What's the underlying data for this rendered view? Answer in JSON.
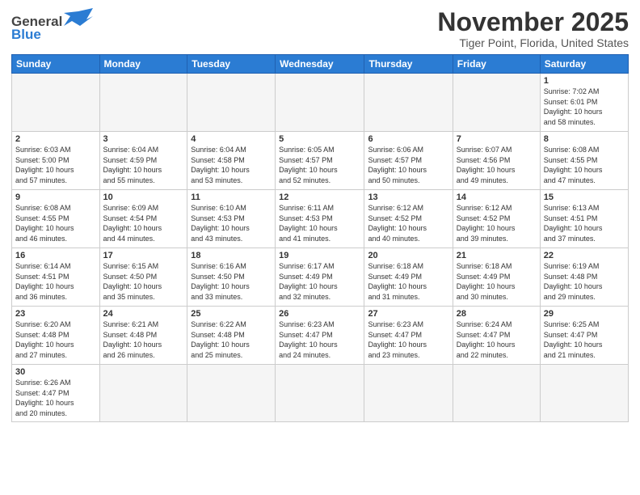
{
  "logo": {
    "text_general": "General",
    "text_blue": "Blue"
  },
  "title": "November 2025",
  "subtitle": "Tiger Point, Florida, United States",
  "days_of_week": [
    "Sunday",
    "Monday",
    "Tuesday",
    "Wednesday",
    "Thursday",
    "Friday",
    "Saturday"
  ],
  "weeks": [
    [
      {
        "day": "",
        "info": ""
      },
      {
        "day": "",
        "info": ""
      },
      {
        "day": "",
        "info": ""
      },
      {
        "day": "",
        "info": ""
      },
      {
        "day": "",
        "info": ""
      },
      {
        "day": "",
        "info": ""
      },
      {
        "day": "1",
        "info": "Sunrise: 7:02 AM\nSunset: 6:01 PM\nDaylight: 10 hours\nand 58 minutes."
      }
    ],
    [
      {
        "day": "2",
        "info": "Sunrise: 6:03 AM\nSunset: 5:00 PM\nDaylight: 10 hours\nand 57 minutes."
      },
      {
        "day": "3",
        "info": "Sunrise: 6:04 AM\nSunset: 4:59 PM\nDaylight: 10 hours\nand 55 minutes."
      },
      {
        "day": "4",
        "info": "Sunrise: 6:04 AM\nSunset: 4:58 PM\nDaylight: 10 hours\nand 53 minutes."
      },
      {
        "day": "5",
        "info": "Sunrise: 6:05 AM\nSunset: 4:57 PM\nDaylight: 10 hours\nand 52 minutes."
      },
      {
        "day": "6",
        "info": "Sunrise: 6:06 AM\nSunset: 4:57 PM\nDaylight: 10 hours\nand 50 minutes."
      },
      {
        "day": "7",
        "info": "Sunrise: 6:07 AM\nSunset: 4:56 PM\nDaylight: 10 hours\nand 49 minutes."
      },
      {
        "day": "8",
        "info": "Sunrise: 6:08 AM\nSunset: 4:55 PM\nDaylight: 10 hours\nand 47 minutes."
      }
    ],
    [
      {
        "day": "9",
        "info": "Sunrise: 6:08 AM\nSunset: 4:55 PM\nDaylight: 10 hours\nand 46 minutes."
      },
      {
        "day": "10",
        "info": "Sunrise: 6:09 AM\nSunset: 4:54 PM\nDaylight: 10 hours\nand 44 minutes."
      },
      {
        "day": "11",
        "info": "Sunrise: 6:10 AM\nSunset: 4:53 PM\nDaylight: 10 hours\nand 43 minutes."
      },
      {
        "day": "12",
        "info": "Sunrise: 6:11 AM\nSunset: 4:53 PM\nDaylight: 10 hours\nand 41 minutes."
      },
      {
        "day": "13",
        "info": "Sunrise: 6:12 AM\nSunset: 4:52 PM\nDaylight: 10 hours\nand 40 minutes."
      },
      {
        "day": "14",
        "info": "Sunrise: 6:12 AM\nSunset: 4:52 PM\nDaylight: 10 hours\nand 39 minutes."
      },
      {
        "day": "15",
        "info": "Sunrise: 6:13 AM\nSunset: 4:51 PM\nDaylight: 10 hours\nand 37 minutes."
      }
    ],
    [
      {
        "day": "16",
        "info": "Sunrise: 6:14 AM\nSunset: 4:51 PM\nDaylight: 10 hours\nand 36 minutes."
      },
      {
        "day": "17",
        "info": "Sunrise: 6:15 AM\nSunset: 4:50 PM\nDaylight: 10 hours\nand 35 minutes."
      },
      {
        "day": "18",
        "info": "Sunrise: 6:16 AM\nSunset: 4:50 PM\nDaylight: 10 hours\nand 33 minutes."
      },
      {
        "day": "19",
        "info": "Sunrise: 6:17 AM\nSunset: 4:49 PM\nDaylight: 10 hours\nand 32 minutes."
      },
      {
        "day": "20",
        "info": "Sunrise: 6:18 AM\nSunset: 4:49 PM\nDaylight: 10 hours\nand 31 minutes."
      },
      {
        "day": "21",
        "info": "Sunrise: 6:18 AM\nSunset: 4:49 PM\nDaylight: 10 hours\nand 30 minutes."
      },
      {
        "day": "22",
        "info": "Sunrise: 6:19 AM\nSunset: 4:48 PM\nDaylight: 10 hours\nand 29 minutes."
      }
    ],
    [
      {
        "day": "23",
        "info": "Sunrise: 6:20 AM\nSunset: 4:48 PM\nDaylight: 10 hours\nand 27 minutes."
      },
      {
        "day": "24",
        "info": "Sunrise: 6:21 AM\nSunset: 4:48 PM\nDaylight: 10 hours\nand 26 minutes."
      },
      {
        "day": "25",
        "info": "Sunrise: 6:22 AM\nSunset: 4:48 PM\nDaylight: 10 hours\nand 25 minutes."
      },
      {
        "day": "26",
        "info": "Sunrise: 6:23 AM\nSunset: 4:47 PM\nDaylight: 10 hours\nand 24 minutes."
      },
      {
        "day": "27",
        "info": "Sunrise: 6:23 AM\nSunset: 4:47 PM\nDaylight: 10 hours\nand 23 minutes."
      },
      {
        "day": "28",
        "info": "Sunrise: 6:24 AM\nSunset: 4:47 PM\nDaylight: 10 hours\nand 22 minutes."
      },
      {
        "day": "29",
        "info": "Sunrise: 6:25 AM\nSunset: 4:47 PM\nDaylight: 10 hours\nand 21 minutes."
      }
    ],
    [
      {
        "day": "30",
        "info": "Sunrise: 6:26 AM\nSunset: 4:47 PM\nDaylight: 10 hours\nand 20 minutes."
      },
      {
        "day": "",
        "info": ""
      },
      {
        "day": "",
        "info": ""
      },
      {
        "day": "",
        "info": ""
      },
      {
        "day": "",
        "info": ""
      },
      {
        "day": "",
        "info": ""
      },
      {
        "day": "",
        "info": ""
      }
    ]
  ]
}
